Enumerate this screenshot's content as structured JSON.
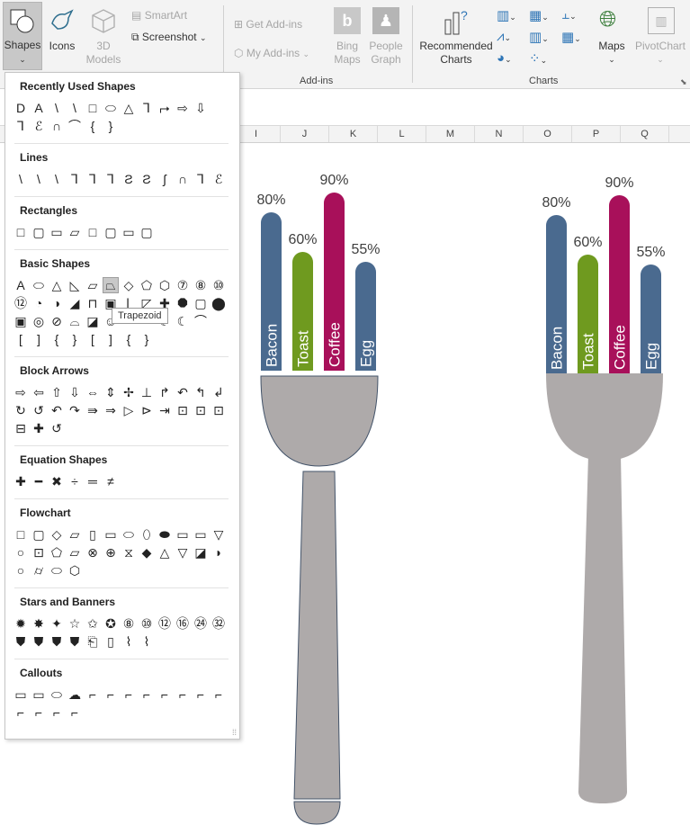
{
  "ribbon": {
    "shapes_label": "Shapes",
    "icons_label": "Icons",
    "models3d_label_1": "3D",
    "models3d_label_2": "Models",
    "smartart_label": "SmartArt",
    "screenshot_label": "Screenshot",
    "get_addins_label": "Get Add-ins",
    "my_addins_label": "My Add-ins",
    "bing_maps_1": "Bing",
    "bing_maps_2": "Maps",
    "people_graph_1": "People",
    "people_graph_2": "Graph",
    "recommended_charts_1": "Recommended",
    "recommended_charts_2": "Charts",
    "maps_label": "Maps",
    "pivotchart_label": "PivotChart",
    "group_addins": "Add-ins",
    "group_charts": "Charts"
  },
  "columns": [
    "I",
    "J",
    "K",
    "L",
    "M",
    "N",
    "O",
    "P",
    "Q"
  ],
  "shapes_panel": {
    "categories": [
      "Recently Used Shapes",
      "Lines",
      "Rectangles",
      "Basic Shapes",
      "Block Arrows",
      "Equation Shapes",
      "Flowchart",
      "Stars and Banners",
      "Callouts"
    ],
    "tooltip": "Trapezoid",
    "recent_row1": [
      "D",
      "A",
      "\\",
      "\\",
      "□",
      "⬭",
      "△",
      "Ꞁ",
      "⮣",
      "⇨",
      "⇩"
    ],
    "recent_row2": [
      "Ꞁ",
      "ℰ",
      "∩",
      "⌒",
      "{",
      "}"
    ],
    "lines_row": [
      "\\",
      "\\",
      "\\",
      "Ꞁ",
      "Ꞁ",
      "Ꞁ",
      "Ƨ",
      "Ƨ",
      "ʃ",
      "∩",
      "Ꞁ",
      "ℰ"
    ],
    "rect_row": [
      "□",
      "▢",
      "▭",
      "▱",
      "□",
      "▢",
      "▭",
      "▢"
    ],
    "basic_row1": [
      "A",
      "⬭",
      "△",
      "◺",
      "▱",
      "⏢",
      "◇",
      "⬠",
      "⬡",
      "⑦",
      "⑧",
      "⑩"
    ],
    "basic_row2": [
      "⑫",
      "◔",
      "◑",
      "◢",
      "⊓",
      "▣",
      "⌊",
      "◸",
      "✚",
      "⯃",
      "▢",
      "⬤"
    ],
    "basic_row3": [
      "▣",
      "◎",
      "⊘",
      "⌓",
      "◪",
      "☺",
      "",
      "",
      "☾",
      "☾",
      "⌒"
    ],
    "basic_row4": [
      "[",
      "]",
      "{",
      "}",
      "[",
      "]",
      "{",
      "}"
    ],
    "arrows_row1": [
      "⇨",
      "⇦",
      "⇧",
      "⇩",
      "⇔",
      "⇕",
      "✢",
      "⊥",
      "↱",
      "↶",
      "↰",
      "↲"
    ],
    "arrows_row2": [
      "↻",
      "↺",
      "↶",
      "↷",
      "⇛",
      "⇒",
      "▷",
      "⊳",
      "⇥",
      "⊡",
      "⊡",
      "⊡"
    ],
    "arrows_row3": [
      "⊟",
      "✚",
      "↺"
    ],
    "equation_row": [
      "✚",
      "━",
      "✖",
      "÷",
      "═",
      "≠"
    ],
    "flow_row1": [
      "□",
      "▢",
      "◇",
      "▱",
      "▯",
      "▭",
      "⬭",
      "⬯",
      "⬬",
      "▭",
      "▭",
      "▽"
    ],
    "flow_row2": [
      "○",
      "⊡",
      "⬠",
      "▱",
      "⊗",
      "⊕",
      "⧖",
      "◆",
      "△",
      "▽",
      "◪",
      "◗"
    ],
    "flow_row3": [
      "○",
      "⌭",
      "⬭",
      "⬡"
    ],
    "stars_row1": [
      "✹",
      "✸",
      "✦",
      "☆",
      "✩",
      "✪",
      "⑧",
      "⑩",
      "⑫",
      "⑯",
      "㉔",
      "㉜"
    ],
    "stars_row2": [
      "⛊",
      "⛊",
      "⛊",
      "⛊",
      "⎗",
      "▯",
      "⌇",
      "⌇"
    ],
    "callouts_row1": [
      "▭",
      "▭",
      "⬭",
      "☁",
      "⌐",
      "⌐",
      "⌐",
      "⌐",
      "⌐",
      "⌐",
      "⌐",
      "⌐"
    ],
    "callouts_row2": [
      "⌐",
      "⌐",
      "⌐",
      "⌐"
    ]
  },
  "chart_data": [
    {
      "type": "bar",
      "categories": [
        "Bacon",
        "Toast",
        "Coffee",
        "Egg"
      ],
      "values": [
        80,
        60,
        90,
        55
      ],
      "value_labels": [
        "80%",
        "60%",
        "90%",
        "55%"
      ],
      "ylim": [
        0,
        100
      ],
      "colors": [
        "#4a6a8f",
        "#6f9a1f",
        "#a8105a",
        "#4a6a8f"
      ]
    },
    {
      "type": "bar",
      "categories": [
        "Bacon",
        "Toast",
        "Coffee",
        "Egg"
      ],
      "values": [
        80,
        60,
        90,
        55
      ],
      "value_labels": [
        "80%",
        "60%",
        "90%",
        "55%"
      ],
      "ylim": [
        0,
        100
      ],
      "colors": [
        "#4a6a8f",
        "#6f9a1f",
        "#a8105a",
        "#4a6a8f"
      ]
    }
  ],
  "colors": {
    "fork_gray": "#aeaaaa",
    "fork_outline": "#44546a"
  }
}
